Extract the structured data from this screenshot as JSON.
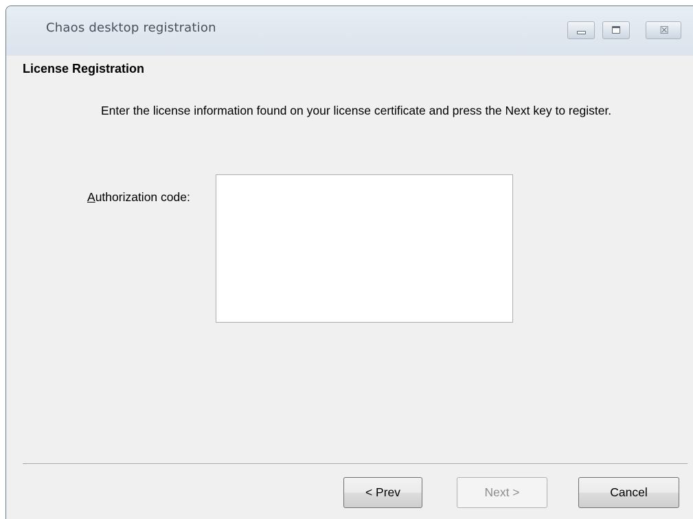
{
  "window": {
    "title": "Chaos desktop registration",
    "controls": {
      "minimize_icon": "minimize-icon",
      "maximize_icon": "maximize-icon",
      "close_icon": "close-icon",
      "close_glyph": "☒"
    }
  },
  "page": {
    "section_title": "License Registration",
    "instructions": "Enter the license information found on your license certificate and press the Next key to register.",
    "auth_label_mnemonic": "A",
    "auth_label_rest": "uthorization code:",
    "auth_value": ""
  },
  "buttons": {
    "prev_label": "< Prev",
    "next_label": "Next >",
    "cancel_label": "Cancel",
    "next_enabled": false
  },
  "colors": {
    "titlebar": "#dee5ed",
    "body": "#f0f0f0",
    "disabled_text": "#8d8d8d"
  }
}
